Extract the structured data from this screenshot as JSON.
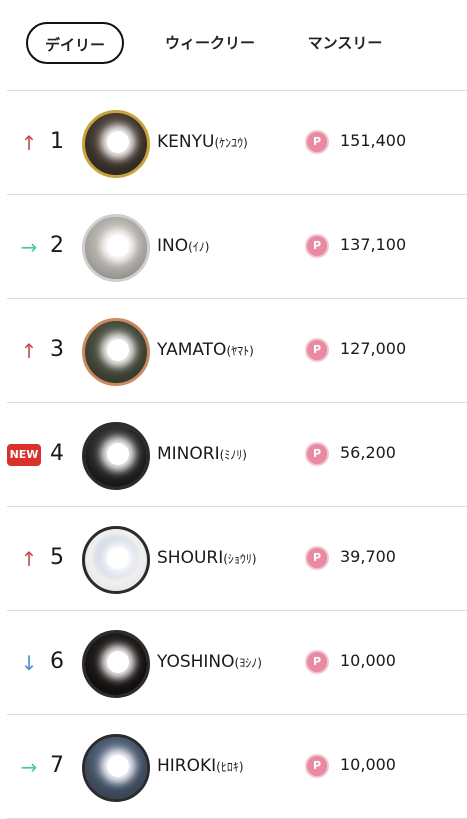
{
  "tabs": {
    "daily": "デイリー",
    "weekly": "ウィークリー",
    "monthly": "マンスリー"
  },
  "point_symbol": "P",
  "colors": {
    "trend_up": "#cf4b52",
    "trend_same": "#4fc79b",
    "trend_down": "#4c8fd6",
    "new_badge": "#d8312e",
    "point_icon": "#e78aa2"
  },
  "ranking": [
    {
      "trend": "up",
      "trend_glyph": "↑",
      "rank": "1",
      "name": "KENYU",
      "kana": "(ｹﾝﾕｳ)",
      "points": "151,400",
      "frame_color": "#c7a43a"
    },
    {
      "trend": "same",
      "trend_glyph": "→",
      "rank": "2",
      "name": "INO",
      "kana": "(ｲﾉ)",
      "points": "137,100",
      "frame_color": "#cfcfcf"
    },
    {
      "trend": "up",
      "trend_glyph": "↑",
      "rank": "3",
      "name": "YAMATO",
      "kana": "(ﾔﾏﾄ)",
      "points": "127,000",
      "frame_color": "#c98a5e"
    },
    {
      "trend": "new",
      "trend_glyph": "NEW",
      "rank": "4",
      "name": "MINORI",
      "kana": "(ﾐﾉﾘ)",
      "points": "56,200",
      "frame_color": "#2b2b2b"
    },
    {
      "trend": "up",
      "trend_glyph": "↑",
      "rank": "5",
      "name": "SHOURI",
      "kana": "(ｼｮｳﾘ)",
      "points": "39,700",
      "frame_color": "#2b2b2b"
    },
    {
      "trend": "down",
      "trend_glyph": "↓",
      "rank": "6",
      "name": "YOSHINO",
      "kana": "(ﾖｼﾉ)",
      "points": "10,000",
      "frame_color": "#2b2b2b"
    },
    {
      "trend": "same",
      "trend_glyph": "→",
      "rank": "7",
      "name": "HIROKI",
      "kana": "(ﾋﾛｷ)",
      "points": "10,000",
      "frame_color": "#2b2b2b"
    }
  ]
}
